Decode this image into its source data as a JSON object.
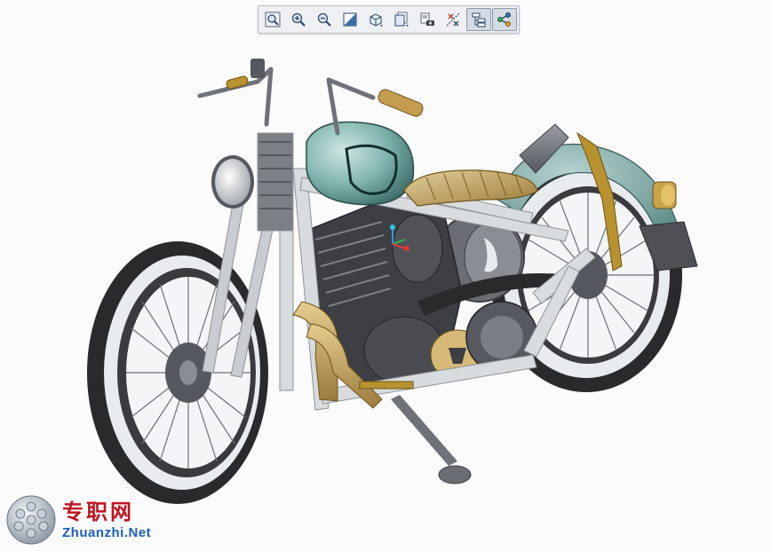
{
  "toolbar": {
    "buttons": [
      {
        "id": "zoom-fit",
        "icon": "zoom-fit-icon"
      },
      {
        "id": "zoom-in",
        "icon": "zoom-in-icon"
      },
      {
        "id": "zoom-out",
        "icon": "zoom-out-icon"
      },
      {
        "id": "shading",
        "icon": "shading-icon"
      },
      {
        "id": "view-orientation",
        "icon": "cube-view-icon"
      },
      {
        "id": "display-style",
        "icon": "display-style-icon"
      },
      {
        "id": "snapshot",
        "icon": "camera-icon"
      },
      {
        "id": "datum-display",
        "icon": "datum-display-icon"
      },
      {
        "id": "model-tree",
        "icon": "model-tree-icon",
        "active": true
      },
      {
        "id": "connections",
        "icon": "connections-icon",
        "active": true
      }
    ]
  },
  "watermark": {
    "cn": "专职网",
    "en": "Zhuanzhi.Net",
    "colors": {
      "cn": "#c1121f",
      "en": "#1b5fb8"
    }
  },
  "colors": {
    "tank": "#7fb3ae",
    "frame": "#d8dcdf",
    "brass": "#b8922e",
    "tire": "#2a2a2c",
    "whitewall": "#e9ecef",
    "engine": "#3d3f44"
  }
}
